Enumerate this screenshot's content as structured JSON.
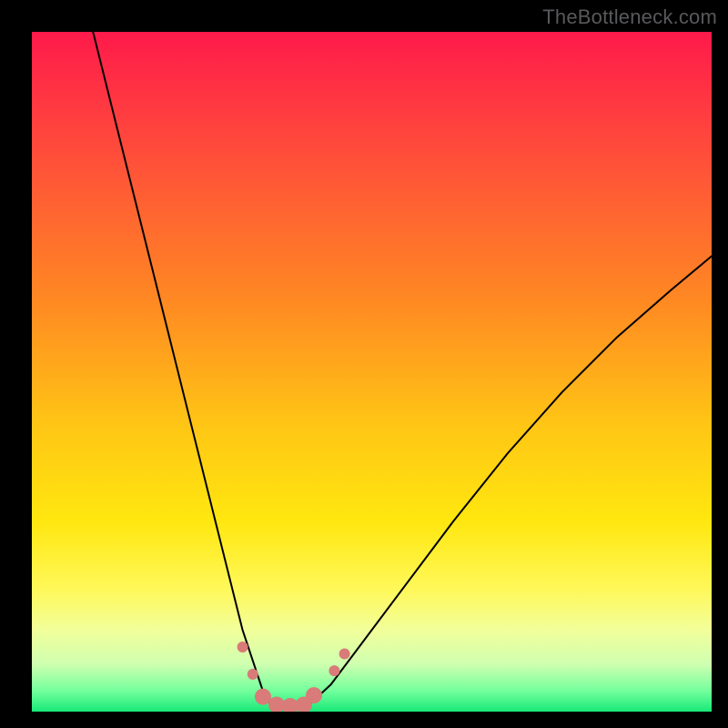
{
  "watermark": "TheBottleneck.com",
  "chart_data": {
    "type": "line",
    "title": "",
    "xlabel": "",
    "ylabel": "",
    "xlim": [
      0,
      100
    ],
    "ylim": [
      0,
      100
    ],
    "grid": false,
    "legend": false,
    "gradient_stops": [
      {
        "offset": 0.0,
        "color": "#ff1a4b"
      },
      {
        "offset": 0.2,
        "color": "#ff5338"
      },
      {
        "offset": 0.4,
        "color": "#ff8a22"
      },
      {
        "offset": 0.58,
        "color": "#ffc615"
      },
      {
        "offset": 0.72,
        "color": "#ffe70f"
      },
      {
        "offset": 0.82,
        "color": "#fff85a"
      },
      {
        "offset": 0.88,
        "color": "#f2ff9a"
      },
      {
        "offset": 0.93,
        "color": "#cfffb0"
      },
      {
        "offset": 0.97,
        "color": "#72ff9c"
      },
      {
        "offset": 1.0,
        "color": "#18e878"
      }
    ],
    "series": [
      {
        "name": "bottleneck-curve",
        "stroke": "#000000",
        "stroke_width": 2,
        "x": [
          9,
          12,
          15,
          18,
          21,
          24,
          27,
          29,
          31,
          33,
          34,
          35,
          36,
          38,
          40,
          41,
          44,
          50,
          56,
          62,
          70,
          78,
          86,
          94,
          100
        ],
        "y": [
          100,
          88,
          76,
          64,
          52,
          40,
          28,
          20,
          12,
          6,
          3,
          1.2,
          0.6,
          0.5,
          0.6,
          1.2,
          4,
          12,
          20,
          28,
          38,
          47,
          55,
          62,
          67
        ]
      }
    ],
    "markers": {
      "name": "flat-region-markers",
      "fill": "#d97b78",
      "radius_primary": 9,
      "radius_secondary": 6,
      "points": [
        {
          "x": 31.0,
          "y": 9.5,
          "r": "secondary"
        },
        {
          "x": 32.5,
          "y": 5.5,
          "r": "secondary"
        },
        {
          "x": 34.0,
          "y": 2.2,
          "r": "primary"
        },
        {
          "x": 36.0,
          "y": 1.0,
          "r": "primary"
        },
        {
          "x": 38.0,
          "y": 0.8,
          "r": "primary"
        },
        {
          "x": 40.0,
          "y": 1.0,
          "r": "primary"
        },
        {
          "x": 41.5,
          "y": 2.4,
          "r": "primary"
        },
        {
          "x": 44.5,
          "y": 6.0,
          "r": "secondary"
        },
        {
          "x": 46.0,
          "y": 8.5,
          "r": "secondary"
        }
      ]
    }
  }
}
